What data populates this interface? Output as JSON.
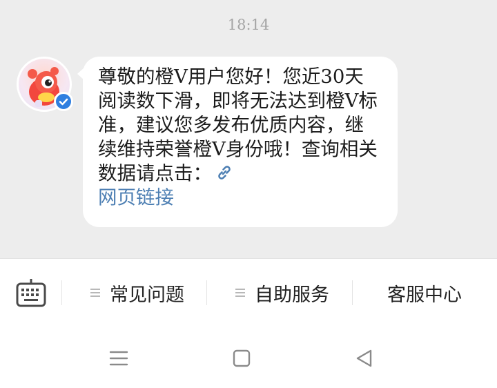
{
  "chat": {
    "timestamp": "18:14",
    "message": {
      "text": "尊敬的橙V用户您好！您近30天阅读数下滑，即将无法达到橙V标准，建议您多发布优质内容，继续维持荣誉橙V身份哦！查询相关数据请点击：",
      "link_icon": "link-icon",
      "link_text": "网页链接"
    },
    "avatar_icon": "mascot-avatar",
    "verified_icon": "verified-badge-icon"
  },
  "toolbar": {
    "keyboard_icon": "keyboard-icon",
    "items": [
      {
        "label": "常见问题",
        "icon": "menu-icon"
      },
      {
        "label": "自助服务",
        "icon": "menu-icon"
      },
      {
        "label": "客服中心"
      }
    ]
  },
  "navbar": {
    "icons": [
      "menu-nav-icon",
      "home-square-icon",
      "back-triangle-icon"
    ]
  },
  "colors": {
    "chat_bg": "#ededed",
    "bubble": "#ffffff",
    "link": "#4d7fb3",
    "verified": "#2f7fe0"
  }
}
